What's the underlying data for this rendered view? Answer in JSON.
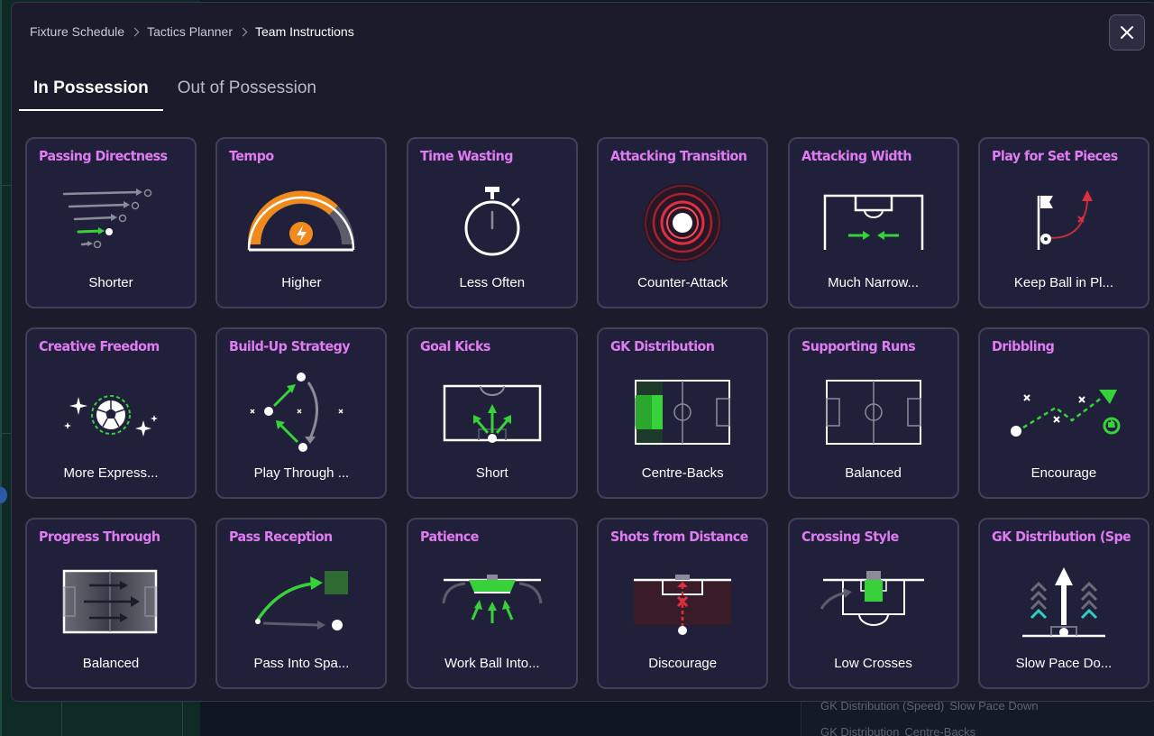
{
  "breadcrumb": {
    "items": [
      "Fixture Schedule",
      "Tactics Planner"
    ],
    "current": "Team Instructions"
  },
  "tabs": [
    {
      "label": "In Possession",
      "active": true
    },
    {
      "label": "Out of Possession",
      "active": false
    }
  ],
  "colors": {
    "title_accent": "#e07cf2",
    "green": "#37d23a",
    "orange": "#f08a1c",
    "red": "#e03040",
    "card_bg": "#20203a"
  },
  "instructions": [
    {
      "title": "Passing Directness",
      "value": "Shorter",
      "icon": "passing-directness-icon"
    },
    {
      "title": "Tempo",
      "value": "Higher",
      "icon": "tempo-gauge-icon"
    },
    {
      "title": "Time Wasting",
      "value": "Less Often",
      "icon": "stopwatch-icon"
    },
    {
      "title": "Attacking Transition",
      "value": "Counter-Attack",
      "icon": "counter-attack-icon"
    },
    {
      "title": "Attacking Width",
      "value": "Much Narrow...",
      "icon": "attacking-width-icon"
    },
    {
      "title": "Play for Set Pieces",
      "value": "Keep Ball in Pl...",
      "icon": "corner-flag-icon"
    },
    {
      "title": "Creative Freedom",
      "value": "More Express...",
      "icon": "creative-ball-icon"
    },
    {
      "title": "Build-Up Strategy",
      "value": "Play Through ...",
      "icon": "build-up-icon"
    },
    {
      "title": "Goal Kicks",
      "value": "Short",
      "icon": "goal-kicks-icon"
    },
    {
      "title": "GK Distribution",
      "value": "Centre-Backs",
      "icon": "gk-distribution-pitch-icon"
    },
    {
      "title": "Supporting Runs",
      "value": "Balanced",
      "icon": "supporting-runs-pitch-icon"
    },
    {
      "title": "Dribbling",
      "value": "Encourage",
      "icon": "dribbling-icon"
    },
    {
      "title": "Progress Through",
      "value": "Balanced",
      "icon": "progress-through-icon"
    },
    {
      "title": "Pass Reception",
      "value": "Pass Into Spa...",
      "icon": "pass-reception-icon"
    },
    {
      "title": "Patience",
      "value": "Work Ball Into...",
      "icon": "patience-icon"
    },
    {
      "title": "Shots from Distance",
      "value": "Discourage",
      "icon": "shots-distance-icon"
    },
    {
      "title": "Crossing Style",
      "value": "Low Crosses",
      "icon": "crossing-style-icon"
    },
    {
      "title": "GK Distribution (Speed)",
      "value": "Slow Pace Do...",
      "icon": "gk-speed-icon"
    }
  ],
  "background_rows": [
    {
      "label": "GK Distribution (Speed)",
      "value": "Slow Pace Down"
    },
    {
      "label": "GK Distribution",
      "value": "Centre-Backs"
    }
  ]
}
